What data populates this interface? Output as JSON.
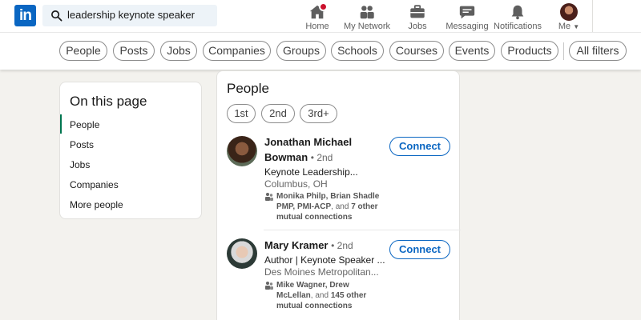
{
  "search": {
    "query": "leadership keynote speaker"
  },
  "logo": {
    "text": "in"
  },
  "nav": {
    "home": "Home",
    "network": "My Network",
    "jobs": "Jobs",
    "messaging": "Messaging",
    "notifications": "Notifications",
    "me": "Me"
  },
  "filters": [
    "People",
    "Posts",
    "Jobs",
    "Companies",
    "Groups",
    "Schools",
    "Courses",
    "Events",
    "Products",
    "All filters"
  ],
  "sidebar": {
    "title": "On this page",
    "items": [
      "People",
      "Posts",
      "Jobs",
      "Companies",
      "More people"
    ]
  },
  "main": {
    "title": "People",
    "degrees": [
      "1st",
      "2nd",
      "3rd+"
    ],
    "connect_label": "Connect",
    "people": [
      {
        "name_line1": "Jonathan Michael",
        "name_line2": "Bowman",
        "degree": "• 2nd",
        "headline": "Keynote Leadership...",
        "location": "Columbus, OH",
        "mutual_line1": "Monika Philp, Brian Shadle",
        "mutual_line2a": "PMP, PMI-ACP",
        "mutual_line2b": ", and ",
        "mutual_line2c": "7 other",
        "mutual_line3": "mutual connections"
      },
      {
        "name": "Mary Kramer",
        "degree": "• 2nd",
        "headline": "Author | Keynote Speaker ...",
        "location": "Des Moines Metropolitan...",
        "mutual_line1": "Mike Wagner, Drew",
        "mutual_line2a": "McLellan",
        "mutual_line2b": ", and ",
        "mutual_line2c": "145 other",
        "mutual_line3": "mutual connections"
      }
    ]
  },
  "colors": {
    "brand": "#0a66c2",
    "active": "#01754f",
    "notification": "#cb112d"
  }
}
